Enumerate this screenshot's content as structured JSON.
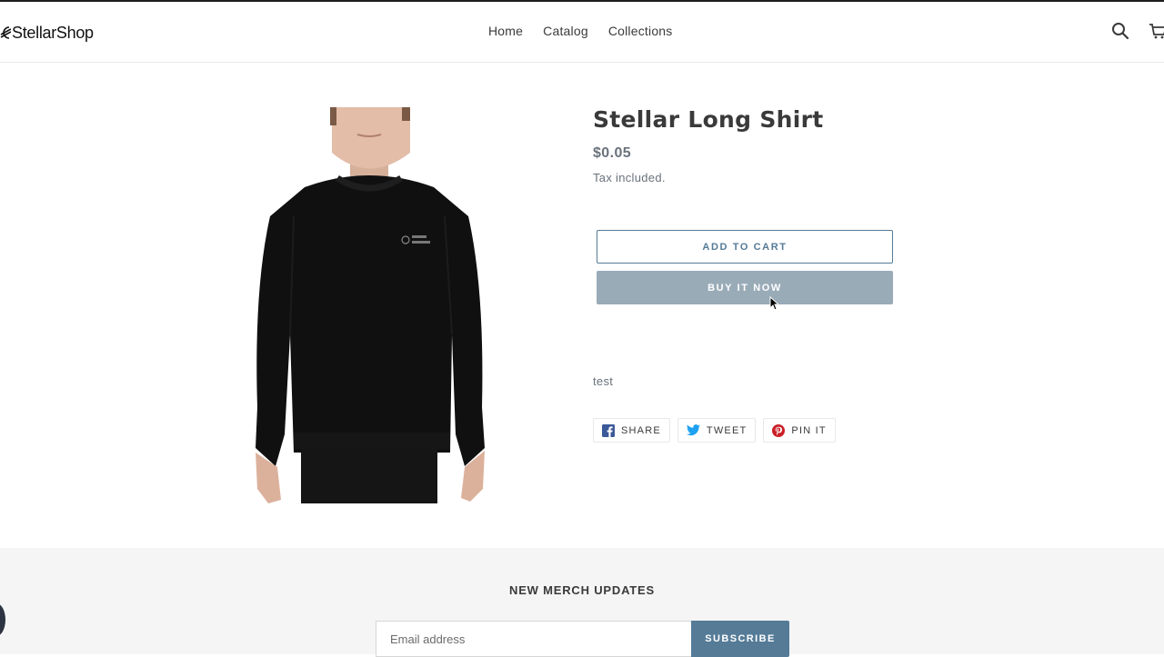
{
  "header": {
    "logo_text": "StellarShop",
    "nav": [
      "Home",
      "Catalog",
      "Collections"
    ],
    "search_icon": "search-icon",
    "cart_icon": "cart-icon"
  },
  "product": {
    "title": "Stellar Long Shirt",
    "price": "$0.05",
    "tax_note": "Tax included.",
    "add_to_cart_label": "ADD TO CART",
    "buy_now_label": "BUY IT NOW",
    "description": "test",
    "logo_print": "Stellar Lumens"
  },
  "share": {
    "facebook_label": "SHARE",
    "twitter_label": "TWEET",
    "pinterest_label": "PIN IT"
  },
  "newsletter": {
    "title": "NEW MERCH UPDATES",
    "email_placeholder": "Email address",
    "subscribe_label": "SUBSCRIBE"
  },
  "colors": {
    "accent": "#557b97",
    "buy_button": "#9aabb8",
    "text": "#3a3a3a",
    "muted": "#69727b",
    "footer_bg": "#f5f5f5"
  }
}
